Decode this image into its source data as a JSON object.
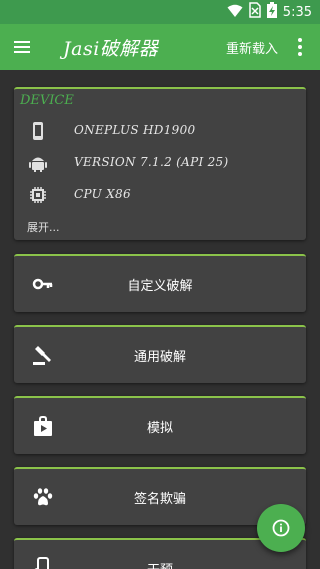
{
  "toolbar": {
    "title": "Jasi破解器",
    "reload_label": "重新载入",
    "accent": "#4caf50"
  },
  "status_bar": {
    "time": "5:35",
    "icons": [
      "wifi-icon",
      "sim-blocked-icon",
      "battery-charging-icon"
    ]
  },
  "device_card": {
    "header": "DEVICE",
    "rows": [
      {
        "icon": "phone-icon",
        "text": "ONEPLUS HD1900"
      },
      {
        "icon": "android-icon",
        "text": "VERSION 7.1.2 (API 25)"
      },
      {
        "icon": "cpu-icon",
        "text": "CPU X86"
      }
    ],
    "expand_label": "展开..."
  },
  "actions": [
    {
      "icon": "key-icon",
      "label": "自定义破解"
    },
    {
      "icon": "gavel-icon",
      "label": "通用破解"
    },
    {
      "icon": "shop-icon",
      "label": "模拟"
    },
    {
      "icon": "paw-icon",
      "label": "签名欺骗"
    },
    {
      "icon": "phone-settings-icon",
      "label": "干预"
    }
  ],
  "fab": {
    "icon": "info-icon"
  }
}
